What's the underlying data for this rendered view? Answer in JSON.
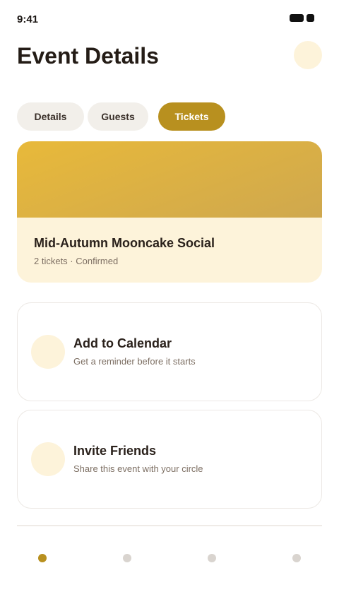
{
  "status_bar": {
    "time": "9:41"
  },
  "header": {
    "title": "Event Details"
  },
  "tabs": [
    {
      "label": "Details",
      "active": false
    },
    {
      "label": "Guests",
      "active": false
    },
    {
      "label": "Tickets",
      "active": true
    }
  ],
  "ticket": {
    "title": "Mid-Autumn Mooncake Social",
    "meta": "2 tickets · Confirmed"
  },
  "actions": [
    {
      "title": "Add to Calendar",
      "subtitle": "Get a reminder before it starts",
      "icon": "calendar-icon"
    },
    {
      "title": "Invite Friends",
      "subtitle": "Share this event with your circle",
      "icon": "invite-icon"
    }
  ],
  "bottom_nav": {
    "items": [
      {
        "name": "nav-home",
        "active": true
      },
      {
        "name": "nav-explore",
        "active": false
      },
      {
        "name": "nav-saved",
        "active": false
      },
      {
        "name": "nav-profile",
        "active": false
      }
    ]
  },
  "colors": {
    "accent": "#b8901f",
    "accent_gradient_start": "#e8b93a",
    "accent_gradient_end": "#cfa84e",
    "cream": "#fdf3da",
    "tab_inactive_bg": "#f2efea",
    "nav_dot_inactive": "#d9d4cf"
  }
}
